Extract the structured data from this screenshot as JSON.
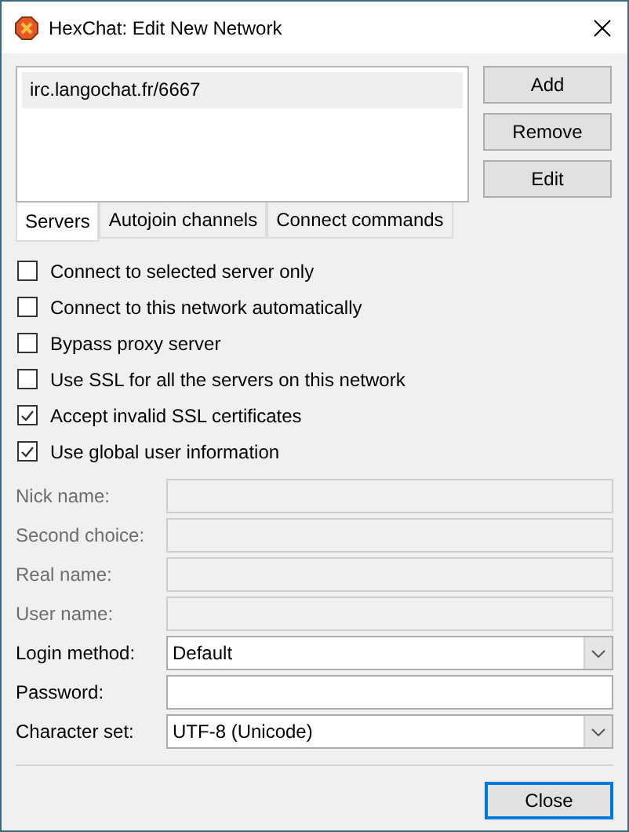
{
  "window": {
    "title": "HexChat: Edit New Network"
  },
  "servers": [
    {
      "label": "irc.langochat.fr/6667",
      "selected": true
    }
  ],
  "server_buttons": [
    "Add",
    "Remove",
    "Edit"
  ],
  "tabs": [
    {
      "label": "Servers",
      "selected": true
    },
    {
      "label": "Autojoin channels",
      "selected": false
    },
    {
      "label": "Connect commands",
      "selected": false
    }
  ],
  "options": [
    {
      "label": "Connect to selected server only",
      "checked": false
    },
    {
      "label": "Connect to this network automatically",
      "checked": false
    },
    {
      "label": "Bypass proxy server",
      "checked": false
    },
    {
      "label": "Use SSL for all the servers on this network",
      "checked": false
    },
    {
      "label": "Accept invalid SSL certificates",
      "checked": true
    },
    {
      "label": "Use global user information",
      "checked": true
    }
  ],
  "fields": [
    {
      "label": "Nick name:",
      "kind": "text",
      "disabled": true
    },
    {
      "label": "Second choice:",
      "kind": "text",
      "disabled": true
    },
    {
      "label": "Real name:",
      "kind": "text",
      "disabled": true
    },
    {
      "label": "User name:",
      "kind": "text",
      "disabled": true
    },
    {
      "label": "Login method:",
      "kind": "select",
      "value": "Default",
      "disabled": false
    },
    {
      "label": "Password:",
      "kind": "text",
      "disabled": false
    },
    {
      "label": "Character set:",
      "kind": "select",
      "value": "UTF-8 (Unicode)",
      "disabled": false
    }
  ],
  "close_button": "Close"
}
